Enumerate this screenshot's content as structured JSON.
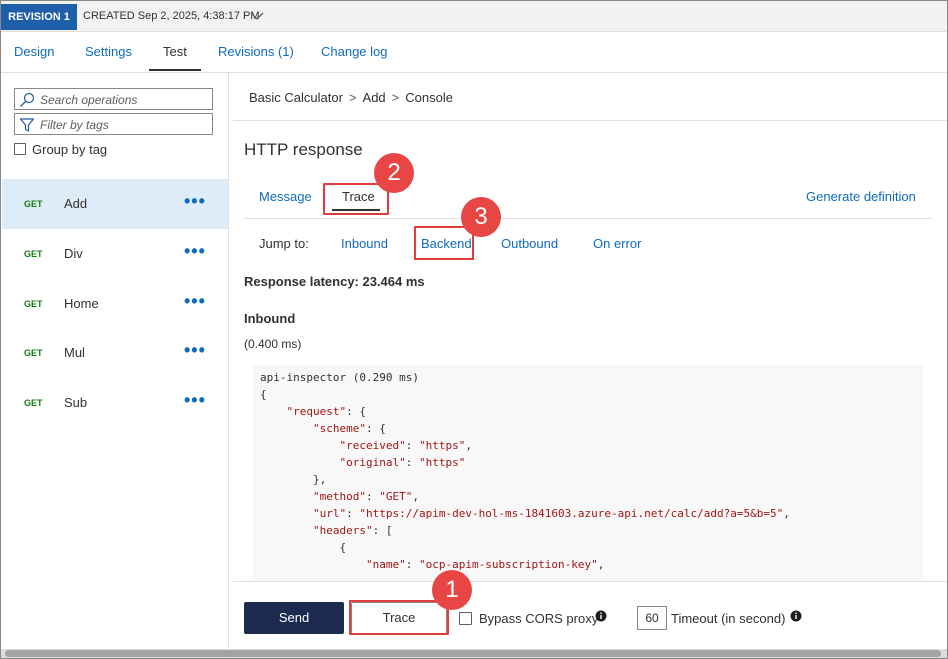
{
  "revision": {
    "badge": "REVISION 1",
    "created": "CREATED Sep 2, 2025, 4:38:17 PM"
  },
  "nav_tabs": [
    {
      "label": "Design"
    },
    {
      "label": "Settings"
    },
    {
      "label": "Test",
      "active": true
    },
    {
      "label": "Revisions (1)"
    },
    {
      "label": "Change log"
    }
  ],
  "sidebar": {
    "search_placeholder": "Search operations",
    "filter_placeholder": "Filter by tags",
    "group_by_label": "Group by tag",
    "group_by_checked": false,
    "operations": [
      {
        "method": "GET",
        "name": "Add",
        "selected": true
      },
      {
        "method": "GET",
        "name": "Div"
      },
      {
        "method": "GET",
        "name": "Home"
      },
      {
        "method": "GET",
        "name": "Mul"
      },
      {
        "method": "GET",
        "name": "Sub"
      }
    ],
    "more_glyph": "•••"
  },
  "breadcrumb": [
    "Basic Calculator",
    "Add",
    "Console"
  ],
  "breadcrumb_sep": ">",
  "response": {
    "title": "HTTP response",
    "tabs": [
      {
        "label": "Message"
      },
      {
        "label": "Trace",
        "active": true
      }
    ],
    "generate_definition": "Generate definition",
    "jump_to_label": "Jump to:",
    "jump_links": [
      {
        "label": "Inbound"
      },
      {
        "label": "Backend"
      },
      {
        "label": "Outbound"
      },
      {
        "label": "On error"
      }
    ],
    "latency_label": "Response latency: 23.464 ms",
    "inbound_heading": "Inbound",
    "inbound_time": "(0.400 ms)"
  },
  "code_lines": [
    "api-inspector (0.290 ms)",
    "{",
    "    \"request\": {",
    "        \"scheme\": {",
    "            \"received\": \"https\",",
    "            \"original\": \"https\"",
    "        },",
    "        \"method\": \"GET\",",
    "        \"url\": \"https://apim-dev-hol-ms-1841603.azure-api.net/calc/add?a=5&b=5\",",
    "        \"headers\": [",
    "            {",
    "                \"name\": \"ocp-apim-subscription-key\","
  ],
  "bottom": {
    "send_label": "Send",
    "trace_label": "Trace",
    "bypass_label": "Bypass CORS proxy",
    "bypass_checked": false,
    "timeout_value": "60",
    "timeout_label": "Timeout (in second)"
  },
  "callouts": [
    {
      "number": "1",
      "target": "trace-button"
    },
    {
      "number": "2",
      "target": "trace-tab"
    },
    {
      "number": "3",
      "target": "backend-link"
    }
  ],
  "colors": {
    "link": "#0f6cbd",
    "revision_badge": "#1f5ea8",
    "send_button": "#1b2a4e",
    "callout": "#e84545",
    "method_get": "#107c10",
    "selected_row": "#deecf9"
  }
}
